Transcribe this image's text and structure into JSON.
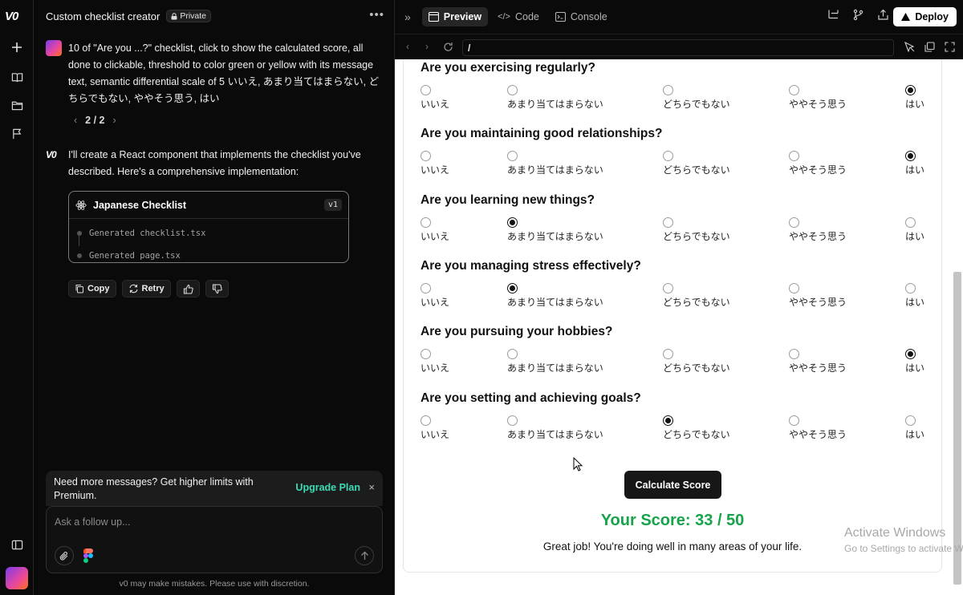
{
  "app": {
    "logo": "V0"
  },
  "chat": {
    "title": "Custom checklist creator",
    "privacy": "Private",
    "user_message": "10 of \"Are you ...?\" checklist, click to show the calculated score, all done to clickable, threshold to color green or yellow with its message text, semantic differential scale of 5 いいえ, あまり当てはまらない, どちらでもない, ややそう思う, はい",
    "pager": "2 / 2",
    "assistant_message": "I'll create a React component that implements the checklist you've described. Here's a comprehensive implementation:",
    "card": {
      "title": "Japanese Checklist",
      "version": "v1",
      "files": [
        "Generated checklist.tsx",
        "Generated page.tsx"
      ]
    },
    "actions": {
      "copy": "Copy",
      "retry": "Retry"
    },
    "upsell": {
      "text": "Need more messages? Get higher limits with Premium.",
      "link": "Upgrade Plan",
      "close": "×"
    },
    "composer": {
      "placeholder": "Ask a follow up..."
    },
    "disclaimer": "v0 may make mistakes. Please use with discretion."
  },
  "toolbar": {
    "tabs": [
      "Preview",
      "Code",
      "Console"
    ],
    "active_tab": "Preview",
    "deploy": "Deploy",
    "url": "/"
  },
  "preview": {
    "options": [
      "いいえ",
      "あまり当てはまらない",
      "どちらでもない",
      "ややそう思う",
      "はい"
    ],
    "questions": [
      {
        "text": "Are you exercising regularly?",
        "selected": 4
      },
      {
        "text": "Are you maintaining good relationships?",
        "selected": 4
      },
      {
        "text": "Are you learning new things?",
        "selected": 1
      },
      {
        "text": "Are you managing stress effectively?",
        "selected": 1
      },
      {
        "text": "Are you pursuing your hobbies?",
        "selected": 4
      },
      {
        "text": "Are you setting and achieving goals?",
        "selected": 2
      }
    ],
    "calculate_button": "Calculate Score",
    "score_text": "Your Score: 33 / 50",
    "score_color": "#16a34a",
    "score_message": "Great job! You're doing well in many areas of your life."
  },
  "watermark": {
    "line1": "Activate Windows",
    "line2": "Go to Settings to activate Windows."
  }
}
